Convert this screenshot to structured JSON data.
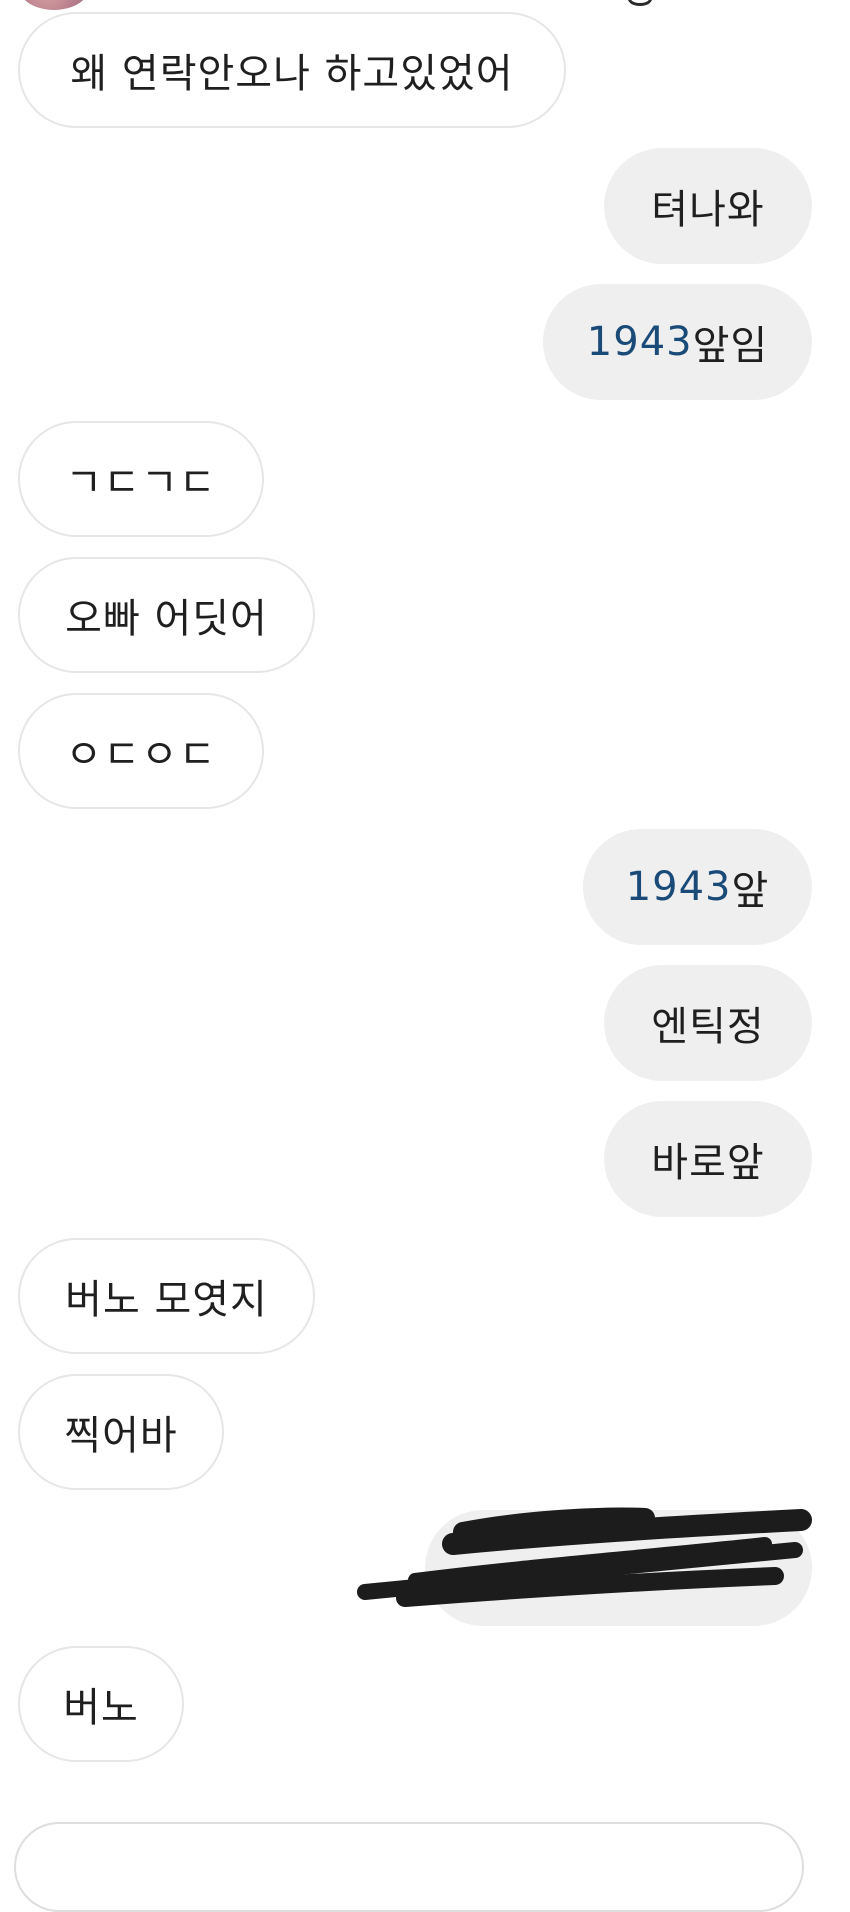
{
  "messages": [
    {
      "side": "in",
      "text": "왜 연락안오나 하고있었어"
    },
    {
      "side": "out",
      "text": "텨나와"
    },
    {
      "side": "out",
      "num": "1943",
      "text": "앞임"
    },
    {
      "side": "in",
      "text": "ㄱㄷㄱㄷ"
    },
    {
      "side": "in",
      "text": "오빠 어딧어"
    },
    {
      "side": "in",
      "text": "ㅇㄷㅇㄷ"
    },
    {
      "side": "out",
      "num": "1943",
      "text": "앞"
    },
    {
      "side": "out",
      "text": "엔틱정"
    },
    {
      "side": "out",
      "text": "바로앞"
    },
    {
      "side": "in",
      "text": "버노 모엿지"
    },
    {
      "side": "in",
      "text": "찍어바"
    },
    {
      "side": "out",
      "redacted": true
    },
    {
      "side": "in",
      "text": "버노"
    }
  ]
}
